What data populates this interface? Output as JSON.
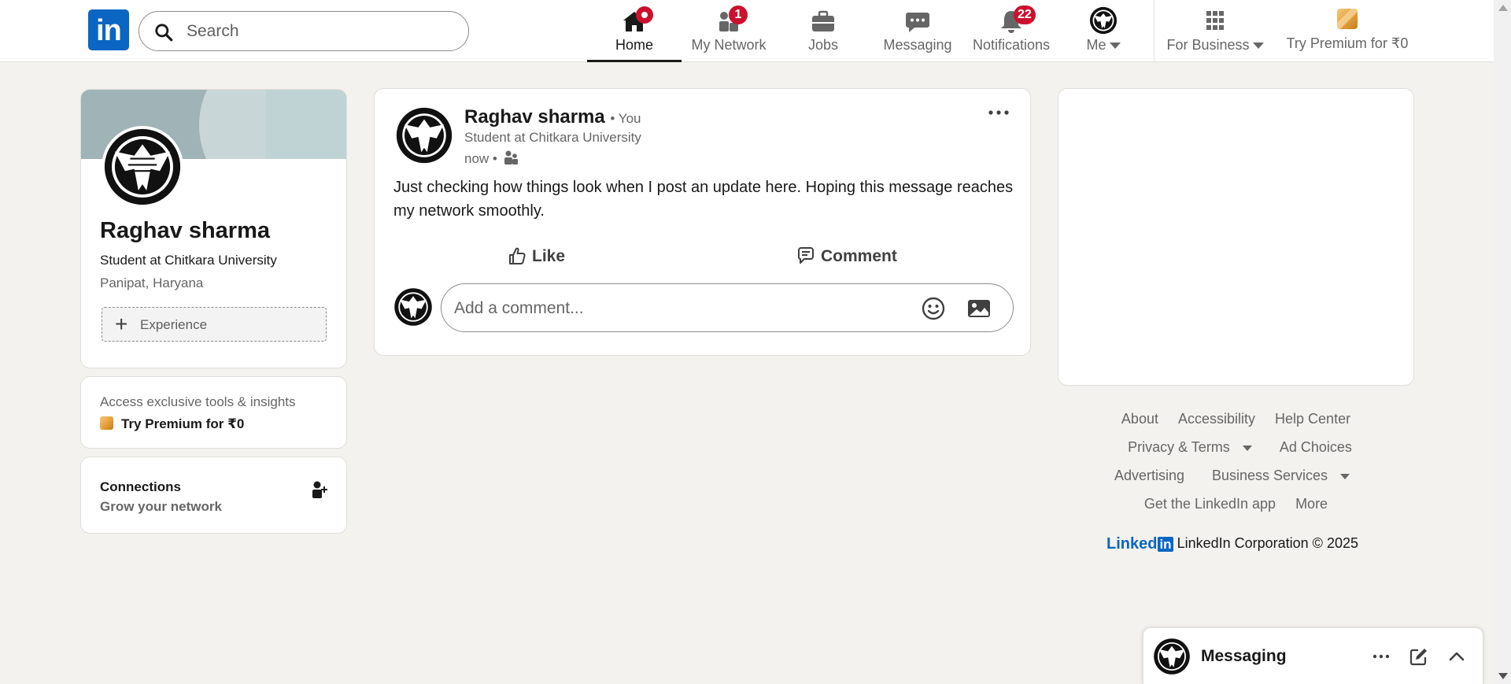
{
  "nav": {
    "search_placeholder": "Search",
    "items": [
      {
        "label": "Home",
        "icon": "home-icon",
        "badge": ""
      },
      {
        "label": "My Network",
        "icon": "network-icon",
        "badge": "1"
      },
      {
        "label": "Jobs",
        "icon": "briefcase-icon",
        "badge": ""
      },
      {
        "label": "Messaging",
        "icon": "chat-icon",
        "badge": ""
      },
      {
        "label": "Notifications",
        "icon": "bell-icon",
        "badge": "22"
      },
      {
        "label": "Me",
        "icon": "avatar",
        "badge": ""
      },
      {
        "label": "For Business",
        "icon": "grid-icon",
        "badge": ""
      },
      {
        "label": "Try Premium for ₹0",
        "icon": "premium-icon",
        "badge": ""
      }
    ],
    "brand_color": "#0a66c2",
    "badge_color": "#cb112d"
  },
  "profile": {
    "name": "Raghav sharma",
    "headline": "Student at Chitkara University",
    "location": "Panipat, Haryana",
    "add_experience": "Experience"
  },
  "premium": {
    "prompt": "Access exclusive tools & insights",
    "cta": "Try Premium for ₹0"
  },
  "connections": {
    "title": "Connections",
    "subtitle": "Grow your network"
  },
  "post": {
    "author": "Raghav sharma",
    "you_tag": "• You",
    "headline": "Student at Chitkara University",
    "time": "now •",
    "body": "Just checking how things look when I post an update here. Hoping this message reaches my network smoothly.",
    "like_label": "Like",
    "comment_label": "Comment",
    "comment_placeholder": "Add a comment..."
  },
  "footer": {
    "links_row1": [
      "About",
      "Accessibility",
      "Help Center"
    ],
    "links_row2": [
      "Privacy & Terms",
      "Ad Choices"
    ],
    "links_row3": [
      "Advertising",
      "Business Services"
    ],
    "links_row4": [
      "Get the LinkedIn app",
      "More"
    ],
    "brand_word": "Linked",
    "brand_in": "in",
    "copyright": "LinkedIn Corporation © 2025"
  },
  "messaging": {
    "title": "Messaging"
  }
}
